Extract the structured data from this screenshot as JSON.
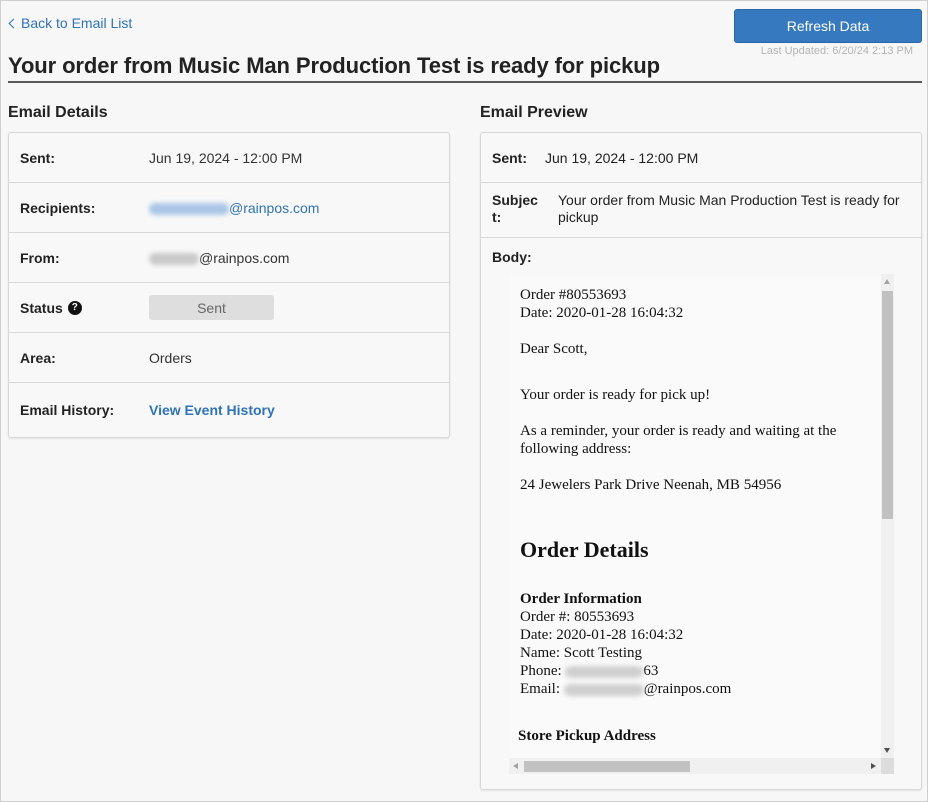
{
  "header": {
    "back_label": "Back to Email List",
    "refresh_label": "Refresh Data",
    "last_updated": "Last Updated: 6/20/24 2:13 PM",
    "title": "Your order from Music Man Production Test is ready for pickup"
  },
  "details": {
    "heading": "Email Details",
    "sent_label": "Sent:",
    "sent_value": "Jun 19, 2024 - 12:00 PM",
    "recipients_label": "Recipients:",
    "recipients_value": "@rainpos.com",
    "from_label": "From:",
    "from_value": "@rainpos.com",
    "status_label": "Status",
    "status_help": "?",
    "status_value": "Sent",
    "area_label": "Area:",
    "area_value": "Orders",
    "history_label": "Email History:",
    "history_link": "View Event History"
  },
  "preview": {
    "heading": "Email Preview",
    "sent_label": "Sent:",
    "sent_value": "Jun 19, 2024 - 12:00 PM",
    "subject_label_1": "Subjec",
    "subject_label_2": "t:",
    "subject_value": "Your order from Music Man Production Test is ready for pickup",
    "body_label": "Body:",
    "body": {
      "order_line": "Order #80553693",
      "date_line": "Date: 2020-01-28 16:04:32",
      "greeting": "Dear Scott,",
      "ready": "Your order is ready for pick up!",
      "reminder": "As a reminder, your order is ready and waiting at the following address:",
      "address": "24 Jewelers Park Drive Neenah, MB 54956",
      "details_heading": "Order Details",
      "info_heading": "Order Information",
      "info_order": "Order #: 80553693",
      "info_date": "Date: 2020-01-28 16:04:32",
      "info_name": "Name: Scott Testing",
      "info_phone_prefix": "Phone:",
      "info_phone_suffix": "63",
      "info_email_prefix": "Email:",
      "info_email_suffix": "@rainpos.com",
      "pickup_heading": "Store Pickup Address"
    }
  },
  "colors": {
    "accent": "#3779be",
    "link": "#2f73b8",
    "status_bg": "#dedede"
  }
}
